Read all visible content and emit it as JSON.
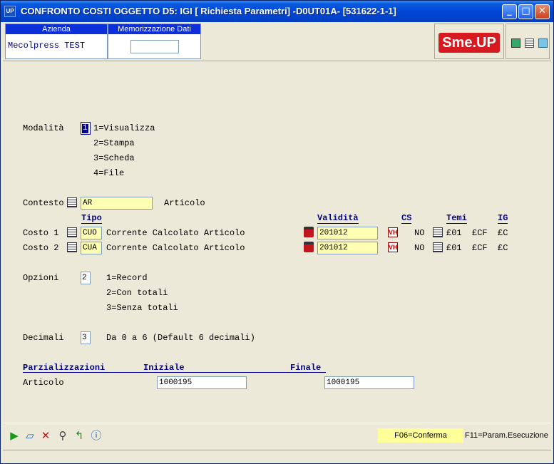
{
  "window": {
    "app_icon": "UP",
    "title": "CONFRONTO COSTI OGGETTO D5: IGI [ Richiesta Parametri] -D0UT01A- [531622-1-1]",
    "controls": [
      "minimize-icon",
      "maximize-icon",
      "close-icon"
    ]
  },
  "header": {
    "azienda_label": "Azienda",
    "azienda_value": "Mecolpress TEST",
    "memo_label": "Memorizzazione Dati Video",
    "memo_value": "",
    "logo_text": "Sme.UP",
    "icons": [
      "monitor-icon",
      "notepad-icon",
      "cube-icon"
    ]
  },
  "form": {
    "modalita": {
      "label": "Modalità",
      "value": "1",
      "options": [
        "1=Visualizza",
        "2=Stampa",
        "3=Scheda",
        "4=File"
      ]
    },
    "contesto": {
      "label": "Contesto",
      "value": "AR",
      "desc": "Articolo"
    },
    "columns": {
      "tipo": "Tipo",
      "validita": "Validità",
      "cs": "CS",
      "temi": "Temi",
      "ig": "IG"
    },
    "costi": [
      {
        "label": "Costo 1",
        "tipo": "CUO",
        "desc": "Corrente Calcolato Articolo",
        "validita": "201012",
        "cs": "NO",
        "temi1": "£01",
        "temi2": "£CF",
        "ig": "£C"
      },
      {
        "label": "Costo 2",
        "tipo": "CUA",
        "desc": "Corrente Calcolato Articolo",
        "validita": "201012",
        "cs": "NO",
        "temi1": "£01",
        "temi2": "£CF",
        "ig": "£C"
      }
    ],
    "opzioni": {
      "label": "Opzioni",
      "value": "2",
      "options": [
        "1=Record",
        "2=Con totali",
        "3=Senza totali"
      ]
    },
    "decimali": {
      "label": "Decimali",
      "value": "3",
      "desc": "Da 0 a 6 (Default 6 decimali)"
    },
    "parzializzazioni": {
      "header": "Parzializzazioni",
      "iniziale_header": "Iniziale",
      "finale_header": "Finale",
      "row_label": "Articolo",
      "iniziale": "1000195",
      "finale": "1000195"
    }
  },
  "toolbar": {
    "icons": [
      "run-icon",
      "eraser-icon",
      "cancel-icon",
      "search-icon",
      "back-arrow-icon",
      "info-icon"
    ],
    "f06": "F06=Conferma",
    "f11": "F11=Param.Esecuzione"
  },
  "colors": {
    "title_bar": "#0246d8",
    "label_blue": "#00008b",
    "field_yellow": "#ffffb3",
    "logo_red": "#d71920"
  }
}
